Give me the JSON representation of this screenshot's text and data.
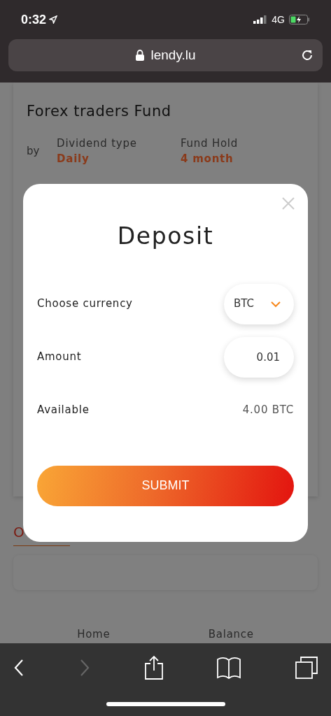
{
  "status_bar": {
    "time": "0:32",
    "network": "4G"
  },
  "address_bar": {
    "url": "lendy.lu"
  },
  "fund_card": {
    "title": "Forex traders Fund",
    "by_label": "by",
    "stats": [
      {
        "label": "Dividend type",
        "value": "Daily"
      },
      {
        "label": "Fund Hold",
        "value": "4 month"
      }
    ]
  },
  "tab_fragment": {
    "label": "O",
    "selected": true
  },
  "bottom_nav": {
    "items": [
      "Home",
      "Balance"
    ]
  },
  "modal": {
    "title": "Deposit",
    "rows": [
      {
        "kind": "select",
        "label": "Choose currency",
        "value": "BTC"
      },
      {
        "kind": "input",
        "label": "Amount",
        "value": "0.01"
      },
      {
        "kind": "text",
        "label": "Available",
        "value": "4.00 BTC"
      }
    ],
    "submit": "SUBMIT"
  }
}
